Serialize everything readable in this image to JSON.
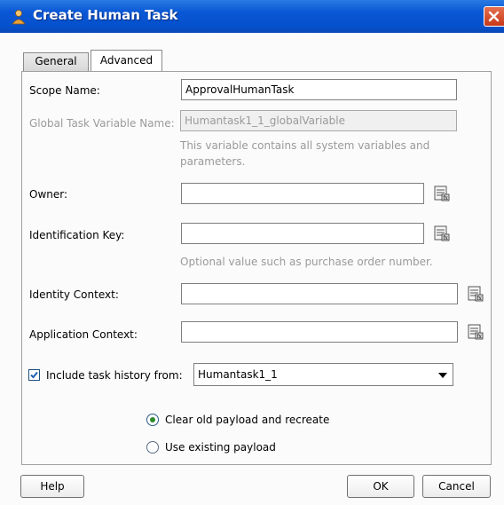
{
  "window": {
    "title": "Create Human Task"
  },
  "tabs": [
    {
      "label": "General",
      "active": false
    },
    {
      "label": "Advanced",
      "active": true
    }
  ],
  "form": {
    "scope_name": {
      "label": "Scope Name:",
      "value": "ApprovalHumanTask"
    },
    "global_task_variable": {
      "label": "Global Task Variable Name:",
      "value": "Humantask1_1_globalVariable",
      "hint_line1": "This variable contains all system variables and",
      "hint_line2": "parameters."
    },
    "owner": {
      "label": "Owner:",
      "value": ""
    },
    "identification_key": {
      "label": "Identification Key:",
      "value": "",
      "hint": "Optional value such as purchase order number."
    },
    "identity_context": {
      "label": "Identity Context:",
      "value": ""
    },
    "application_context": {
      "label": "Application Context:",
      "value": ""
    },
    "include_history": {
      "checked": true,
      "label": "Include task history from:",
      "selected": "Humantask1_1"
    },
    "payload_options": [
      {
        "label": "Clear old payload and recreate",
        "checked": true
      },
      {
        "label": "Use existing payload",
        "checked": false
      }
    ]
  },
  "buttons": {
    "help": "Help",
    "ok": "OK",
    "cancel": "Cancel"
  },
  "colors": {
    "titlebar": "#0a58d6",
    "close": "#c6381a",
    "radio_dot": "#2d8a2d"
  },
  "icons": {
    "title": "human-task-icon",
    "expression": "expression-builder-icon"
  }
}
